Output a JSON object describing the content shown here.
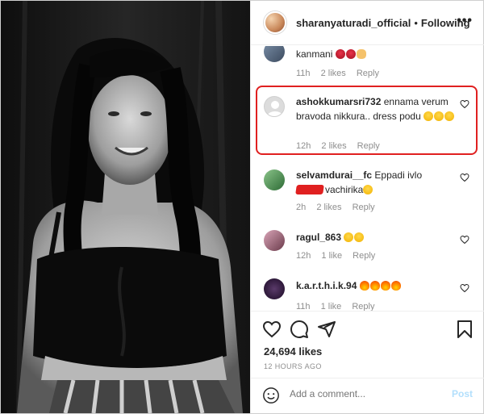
{
  "header": {
    "username": "sharanyaturadi_official",
    "separator": "•",
    "follow_status": "Following",
    "more": "•••"
  },
  "comments": [
    {
      "username": "",
      "text": "kanmani",
      "emoji": [
        "rose",
        "rose",
        "ok"
      ],
      "time": "11h",
      "likes": "2 likes",
      "reply": "Reply"
    },
    {
      "username": "ashokkumarsri732",
      "text": "ennama verum bravoda nikkura.. dress podu",
      "emoji": [
        "laugh",
        "laugh",
        "laugh"
      ],
      "time": "12h",
      "likes": "2 likes",
      "reply": "Reply",
      "highlighted": true
    },
    {
      "username": "selvamdurai__fc",
      "text": "Eppadi ivlo",
      "text2": "vachirika",
      "emoji": [
        "shock"
      ],
      "time": "2h",
      "likes": "2 likes",
      "reply": "Reply"
    },
    {
      "username": "ragul_863",
      "text": "",
      "emoji": [
        "heart-eyes",
        "heart-eyes"
      ],
      "time": "12h",
      "likes": "1 like",
      "reply": "Reply"
    },
    {
      "username": "k.a.r.t.h.i.k.94",
      "text": "",
      "emoji": [
        "fire",
        "fire",
        "fire",
        "fire"
      ],
      "time": "11h",
      "likes": "1 like",
      "reply": "Reply"
    }
  ],
  "actions": {
    "likes_count": "24,694 likes",
    "timestamp": "12 HOURS AGO",
    "add_comment_placeholder": "Add a comment...",
    "post_label": "Post"
  },
  "colors": {
    "highlight": "#e02020",
    "post_disabled": "#b2dffc",
    "meta_gray": "#8e8e8e"
  },
  "icons": [
    "heart-icon",
    "comment-icon",
    "share-icon",
    "save-icon",
    "emoji-icon",
    "more-icon"
  ]
}
